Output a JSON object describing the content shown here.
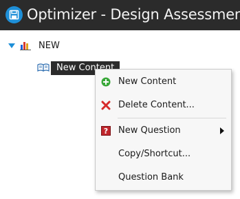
{
  "window": {
    "title": "Optimizer - Design Assessment",
    "app_icon": "floppy-disk-icon",
    "accent_color": "#1e8fd8"
  },
  "tree": {
    "root": {
      "label": "NEW",
      "icon": "bar-chart-icon",
      "expanded": true
    },
    "child": {
      "label": "New Content",
      "icon": "open-book-icon",
      "selected": true
    }
  },
  "context_menu": {
    "items": [
      {
        "label": "New Content",
        "icon": "green-plus-icon"
      },
      {
        "label": "Delete Content...",
        "icon": "red-x-icon"
      },
      {
        "label": "New Question",
        "icon": "red-question-icon",
        "has_submenu": true
      },
      {
        "label": "Copy/Shortcut...",
        "icon": ""
      },
      {
        "label": "Question Bank",
        "icon": ""
      }
    ]
  }
}
